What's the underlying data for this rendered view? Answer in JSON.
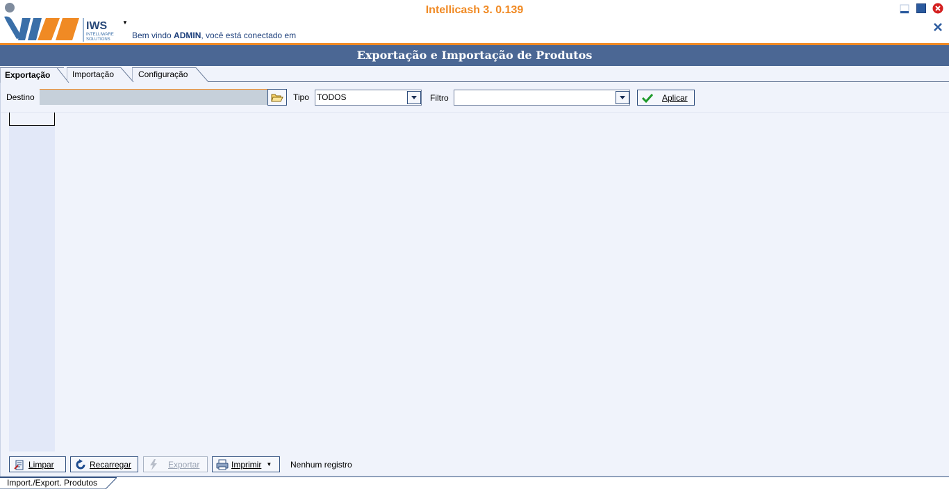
{
  "app": {
    "title": "Intellicash 3. 0.139",
    "welcome_prefix": "Bem vindo ",
    "user": "ADMIN",
    "welcome_suffix": ", você está conectado em",
    "logo_text": "IWS",
    "logo_subtext_1": "INTELLIWARE",
    "logo_subtext_2": "SOLUTIONS"
  },
  "window": {
    "title": "Exportação e Importação de Produtos"
  },
  "tabs": [
    {
      "label": "Exportação",
      "active": true
    },
    {
      "label": "Importação",
      "active": false
    },
    {
      "label": "Configuração",
      "active": false
    }
  ],
  "toolbar": {
    "destino_label": "Destino",
    "destino_value": "",
    "tipo_label": "Tipo",
    "tipo_value": "TODOS",
    "filtro_label": "Filtro",
    "filtro_value": "",
    "aplicar_label": "Aplicar"
  },
  "actions": {
    "limpar": "Limpar",
    "recarregar": "Recarregar",
    "exportar": "Exportar",
    "imprimir": "Imprimir",
    "status": "Nenhum registro"
  },
  "footer": {
    "tab_label": "Import./Export. Produtos"
  },
  "colors": {
    "accent": "#f08a24",
    "title_bar": "#4b6794",
    "border": "#31507f",
    "background": "#f0f3fb"
  }
}
